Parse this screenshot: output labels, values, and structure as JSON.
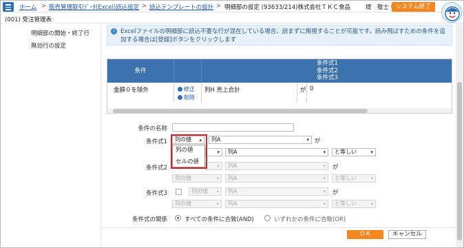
{
  "header": {
    "breadcrumbs": [
      {
        "label": "ホーム",
        "link": true
      },
      {
        "label": "販売管理取引ﾃﾞｰﾀ(Excel)読込設定",
        "link": true
      },
      {
        "label": "読込テンプレートの設計",
        "link": true
      },
      {
        "label": "明細部の設定 (93633/214)株式会社ＴＫＣ食品",
        "link": false
      }
    ],
    "separator": ">",
    "user": "堤　敬士 ▾",
    "system_end_label": "システム終了",
    "sub_title": "(001) 受注管理表"
  },
  "sidebar": {
    "items": [
      "明細部の開始・終了行",
      "無効行の設定"
    ]
  },
  "info": {
    "icon": "i",
    "text": "Excelファイルの明細部に読込不要な行が混在している場合、読まずに無視することが可能です。読み飛ばすための条件を追加する場合は[登録]ボタンをクリックします"
  },
  "table": {
    "headers": {
      "condition": "条件",
      "expr1": "条件式1",
      "expr2": "条件式2",
      "expr3": "条件式3"
    },
    "rows": [
      {
        "condition": "金額０を除外",
        "edit": "修正",
        "delete": "削除",
        "col": "列H 売上合計",
        "particle": "が",
        "value": "0"
      }
    ]
  },
  "form": {
    "name_label": "条件の名称",
    "name_value": "",
    "expr1_label": "条件式1",
    "expr2_label": "条件式2",
    "expr3_label": "条件式3",
    "value_type_col": "列の値",
    "value_type_cell": "セルの値",
    "col_a": "列A",
    "particle": "が",
    "equal": "と等しい",
    "dropdown_options": [
      "列の値",
      "セルの値"
    ],
    "relation_label": "条件式の関係",
    "relation_and": "すべての条件に合致(AND)",
    "relation_or": "いずれかの条件に合致(OR)"
  },
  "footer": {
    "ok": "ＯＫ",
    "cancel": "キャンセル"
  },
  "colors": {
    "accent_orange": "#f3861f",
    "table_header_blue": "#3c73ad",
    "link_blue": "#1a55b0",
    "highlight_red": "#d5232a"
  }
}
